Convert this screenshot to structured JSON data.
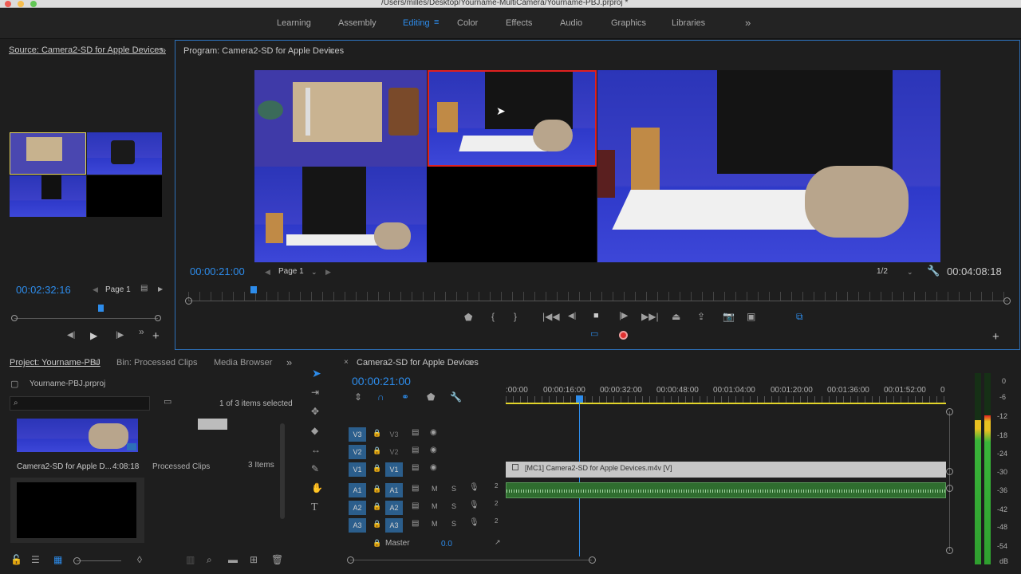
{
  "window": {
    "title": "/Users/milles/Desktop/Yourname-MultiCamera/Yourname-PBJ.prproj *"
  },
  "workspaces": [
    {
      "label": "Learning",
      "active": false
    },
    {
      "label": "Assembly",
      "active": false
    },
    {
      "label": "Editing",
      "active": true
    },
    {
      "label": "Color",
      "active": false
    },
    {
      "label": "Effects",
      "active": false
    },
    {
      "label": "Audio",
      "active": false
    },
    {
      "label": "Graphics",
      "active": false
    },
    {
      "label": "Libraries",
      "active": false
    }
  ],
  "source_monitor": {
    "title": "Source: Camera2-SD for Apple Devices.",
    "timecode": "00:02:32:16",
    "page": "Page 1"
  },
  "program_monitor": {
    "title": "Program: Camera2-SD for Apple Devices",
    "timecode": "00:00:21:00",
    "page": "Page 1",
    "resolution": "1/2",
    "duration": "00:04:08:18"
  },
  "project_panel": {
    "tabs": [
      "Project: Yourname-PBJ",
      "Bin: Processed Clips",
      "Media Browser"
    ],
    "file": "Yourname-PBJ.prproj",
    "search_placeholder": "",
    "selection_status": "1 of 3 items selected",
    "items": [
      {
        "name": "Camera2-SD for Apple D...",
        "meta": "4:08:18"
      },
      {
        "name": "Processed Clips",
        "meta": "3 Items"
      }
    ]
  },
  "timeline": {
    "sequence": "Camera2-SD for Apple Devices",
    "timecode": "00:00:21:00",
    "ruler": [
      ":00:00",
      "00:00:16:00",
      "00:00:32:00",
      "00:00:48:00",
      "00:01:04:00",
      "00:01:20:00",
      "00:01:36:00",
      "00:01:52:00",
      "0"
    ],
    "video_tracks": [
      {
        "src": "V3",
        "tgt": "V3"
      },
      {
        "src": "V2",
        "tgt": "V2"
      },
      {
        "src": "V1",
        "tgt": "V1"
      }
    ],
    "audio_tracks": [
      {
        "src": "A1",
        "tgt": "A1"
      },
      {
        "src": "A2",
        "tgt": "A2"
      },
      {
        "src": "A3",
        "tgt": "A3"
      }
    ],
    "master_label": "Master",
    "master_value": "0.0",
    "video_clip": "[MC1] Camera2-SD for Apple Devices.m4v [V]",
    "mute": "M",
    "solo": "S",
    "chan": "2"
  },
  "meters": {
    "labels": [
      "0",
      "-6",
      "-12",
      "-18",
      "-24",
      "-30",
      "-36",
      "-42",
      "-48",
      "-54",
      "dB"
    ],
    "level_fraction": 0.78
  },
  "colors": {
    "accent": "#2d8ceb",
    "record": "#e03030",
    "clip_video": "#c7c7c7",
    "clip_audio": "#2f6d2f"
  }
}
